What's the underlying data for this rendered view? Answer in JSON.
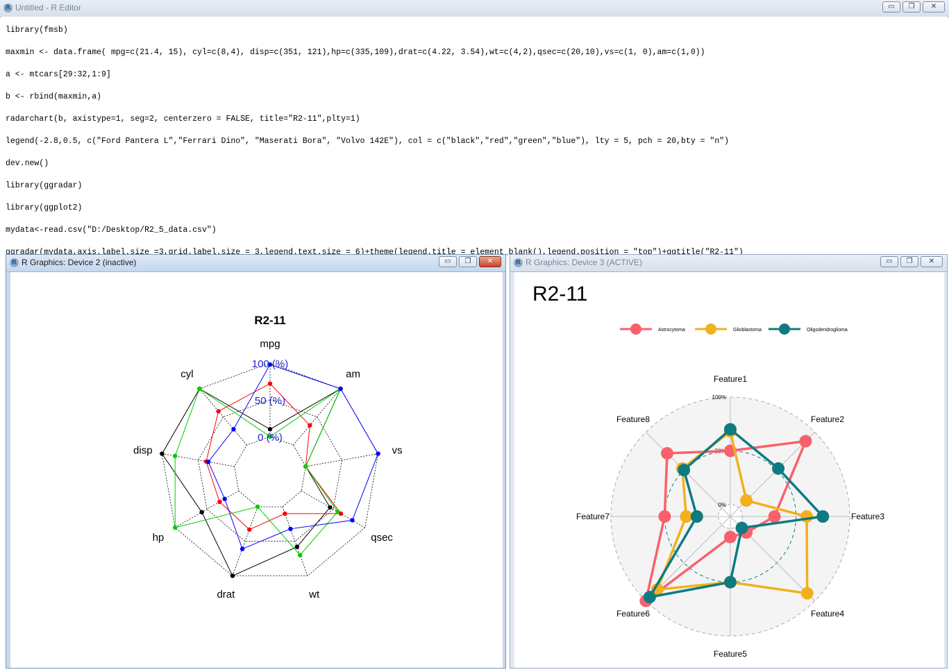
{
  "editor": {
    "title": "Untitled - R Editor",
    "lines": [
      "library(fmsb)",
      "maxmin <- data.frame( mpg=c(21.4, 15), cyl=c(8,4), disp=c(351, 121),hp=c(335,109),drat=c(4.22, 3.54),wt=c(4,2),qsec=c(20,10),vs=c(1, 0),am=c(1,0))",
      "a <- mtcars[29:32,1:9]",
      "b <- rbind(maxmin,a)",
      "radarchart(b, axistype=1, seg=2, centerzero = FALSE, title=\"R2-11\",plty=1)",
      "legend(-2.8,0.5, c(\"Ford Pantera L\",\"Ferrari Dino\", \"Maserati Bora\", \"Volvo 142E\"), col = c(\"black\",\"red\",\"green\",\"blue\"), lty = 5, pch = 20,bty = \"n\")",
      "dev.new()",
      "library(ggradar)",
      "library(ggplot2)",
      "mydata<-read.csv(\"D:/Desktop/R2_5_data.csv\")",
      "ggradar(mydata,axis.label.size =3,grid.label.size = 3,legend.text.size = 6)+theme(legend.title = element_blank(),legend.position = \"top\")+ggtitle(\"R2-11\")"
    ]
  },
  "window_buttons": {
    "minimize": "▭",
    "maximize": "❐",
    "close": "✕"
  },
  "dev2": {
    "title": "R Graphics: Device 2 (inactive)"
  },
  "dev3": {
    "title": "R Graphics: Device 3 (ACTIVE)"
  },
  "chart_data": [
    {
      "type": "radar",
      "title": "R2-11",
      "axes": [
        "mpg",
        "am",
        "vs",
        "qsec",
        "wt",
        "drat",
        "hp",
        "disp",
        "cyl"
      ],
      "grid_labels": [
        "0 (%)",
        "50 (%)",
        "100 (%)"
      ],
      "grid_label_color": "#2222cc",
      "series": [
        {
          "color": "#000000",
          "values": [
            0.1,
            1.0,
            0.0,
            0.45,
            0.58,
            1.0,
            0.58,
            1.0,
            1.0
          ]
        },
        {
          "color": "#ff0000",
          "values": [
            0.72,
            0.35,
            0.0,
            0.62,
            0.1,
            0.33,
            0.3,
            0.39,
            0.6
          ]
        },
        {
          "color": "#00cc00",
          "values": [
            0.0,
            1.0,
            0.0,
            0.57,
            0.7,
            0.0,
            1.0,
            0.82,
            1.0
          ]
        },
        {
          "color": "#0000ff",
          "values": [
            0.98,
            1.0,
            1.0,
            0.8,
            0.32,
            0.61,
            0.22,
            0.36,
            0.28
          ]
        }
      ]
    },
    {
      "type": "radar",
      "title": "R2-11",
      "axes": [
        "Feature1",
        "Feature2",
        "Feature3",
        "Feature4",
        "Feature5",
        "Feature6",
        "Feature7",
        "Feature8"
      ],
      "grid_labels": [
        "0%",
        "50%",
        "100%"
      ],
      "legend_position": "top",
      "series": [
        {
          "name": "Astrocytoma",
          "color": "#F8616C",
          "values": [
            0.5,
            0.88,
            0.3,
            0.1,
            0.08,
            1.0,
            0.5,
            0.72
          ]
        },
        {
          "name": "Glioblastoma",
          "color": "#F2B01E",
          "values": [
            0.68,
            0.1,
            0.6,
            0.9,
            0.5,
            0.85,
            0.3,
            0.52
          ]
        },
        {
          "name": "Oligodendroglioma",
          "color": "#0F7B80",
          "values": [
            0.7,
            0.52,
            0.75,
            0.04,
            0.5,
            0.95,
            0.2,
            0.5
          ]
        }
      ]
    }
  ]
}
